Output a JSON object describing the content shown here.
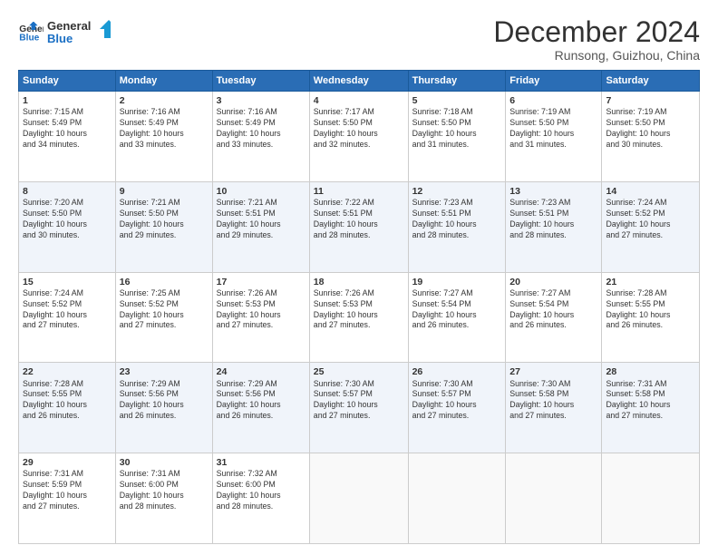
{
  "logo": {
    "line1": "General",
    "line2": "Blue"
  },
  "title": "December 2024",
  "subtitle": "Runsong, Guizhou, China",
  "weekdays": [
    "Sunday",
    "Monday",
    "Tuesday",
    "Wednesday",
    "Thursday",
    "Friday",
    "Saturday"
  ],
  "weeks": [
    [
      {
        "day": "1",
        "info": "Sunrise: 7:15 AM\nSunset: 5:49 PM\nDaylight: 10 hours\nand 34 minutes."
      },
      {
        "day": "2",
        "info": "Sunrise: 7:16 AM\nSunset: 5:49 PM\nDaylight: 10 hours\nand 33 minutes."
      },
      {
        "day": "3",
        "info": "Sunrise: 7:16 AM\nSunset: 5:49 PM\nDaylight: 10 hours\nand 33 minutes."
      },
      {
        "day": "4",
        "info": "Sunrise: 7:17 AM\nSunset: 5:50 PM\nDaylight: 10 hours\nand 32 minutes."
      },
      {
        "day": "5",
        "info": "Sunrise: 7:18 AM\nSunset: 5:50 PM\nDaylight: 10 hours\nand 31 minutes."
      },
      {
        "day": "6",
        "info": "Sunrise: 7:19 AM\nSunset: 5:50 PM\nDaylight: 10 hours\nand 31 minutes."
      },
      {
        "day": "7",
        "info": "Sunrise: 7:19 AM\nSunset: 5:50 PM\nDaylight: 10 hours\nand 30 minutes."
      }
    ],
    [
      {
        "day": "8",
        "info": "Sunrise: 7:20 AM\nSunset: 5:50 PM\nDaylight: 10 hours\nand 30 minutes."
      },
      {
        "day": "9",
        "info": "Sunrise: 7:21 AM\nSunset: 5:50 PM\nDaylight: 10 hours\nand 29 minutes."
      },
      {
        "day": "10",
        "info": "Sunrise: 7:21 AM\nSunset: 5:51 PM\nDaylight: 10 hours\nand 29 minutes."
      },
      {
        "day": "11",
        "info": "Sunrise: 7:22 AM\nSunset: 5:51 PM\nDaylight: 10 hours\nand 28 minutes."
      },
      {
        "day": "12",
        "info": "Sunrise: 7:23 AM\nSunset: 5:51 PM\nDaylight: 10 hours\nand 28 minutes."
      },
      {
        "day": "13",
        "info": "Sunrise: 7:23 AM\nSunset: 5:51 PM\nDaylight: 10 hours\nand 28 minutes."
      },
      {
        "day": "14",
        "info": "Sunrise: 7:24 AM\nSunset: 5:52 PM\nDaylight: 10 hours\nand 27 minutes."
      }
    ],
    [
      {
        "day": "15",
        "info": "Sunrise: 7:24 AM\nSunset: 5:52 PM\nDaylight: 10 hours\nand 27 minutes."
      },
      {
        "day": "16",
        "info": "Sunrise: 7:25 AM\nSunset: 5:52 PM\nDaylight: 10 hours\nand 27 minutes."
      },
      {
        "day": "17",
        "info": "Sunrise: 7:26 AM\nSunset: 5:53 PM\nDaylight: 10 hours\nand 27 minutes."
      },
      {
        "day": "18",
        "info": "Sunrise: 7:26 AM\nSunset: 5:53 PM\nDaylight: 10 hours\nand 27 minutes."
      },
      {
        "day": "19",
        "info": "Sunrise: 7:27 AM\nSunset: 5:54 PM\nDaylight: 10 hours\nand 26 minutes."
      },
      {
        "day": "20",
        "info": "Sunrise: 7:27 AM\nSunset: 5:54 PM\nDaylight: 10 hours\nand 26 minutes."
      },
      {
        "day": "21",
        "info": "Sunrise: 7:28 AM\nSunset: 5:55 PM\nDaylight: 10 hours\nand 26 minutes."
      }
    ],
    [
      {
        "day": "22",
        "info": "Sunrise: 7:28 AM\nSunset: 5:55 PM\nDaylight: 10 hours\nand 26 minutes."
      },
      {
        "day": "23",
        "info": "Sunrise: 7:29 AM\nSunset: 5:56 PM\nDaylight: 10 hours\nand 26 minutes."
      },
      {
        "day": "24",
        "info": "Sunrise: 7:29 AM\nSunset: 5:56 PM\nDaylight: 10 hours\nand 26 minutes."
      },
      {
        "day": "25",
        "info": "Sunrise: 7:30 AM\nSunset: 5:57 PM\nDaylight: 10 hours\nand 27 minutes."
      },
      {
        "day": "26",
        "info": "Sunrise: 7:30 AM\nSunset: 5:57 PM\nDaylight: 10 hours\nand 27 minutes."
      },
      {
        "day": "27",
        "info": "Sunrise: 7:30 AM\nSunset: 5:58 PM\nDaylight: 10 hours\nand 27 minutes."
      },
      {
        "day": "28",
        "info": "Sunrise: 7:31 AM\nSunset: 5:58 PM\nDaylight: 10 hours\nand 27 minutes."
      }
    ],
    [
      {
        "day": "29",
        "info": "Sunrise: 7:31 AM\nSunset: 5:59 PM\nDaylight: 10 hours\nand 27 minutes."
      },
      {
        "day": "30",
        "info": "Sunrise: 7:31 AM\nSunset: 6:00 PM\nDaylight: 10 hours\nand 28 minutes."
      },
      {
        "day": "31",
        "info": "Sunrise: 7:32 AM\nSunset: 6:00 PM\nDaylight: 10 hours\nand 28 minutes."
      },
      null,
      null,
      null,
      null
    ]
  ]
}
